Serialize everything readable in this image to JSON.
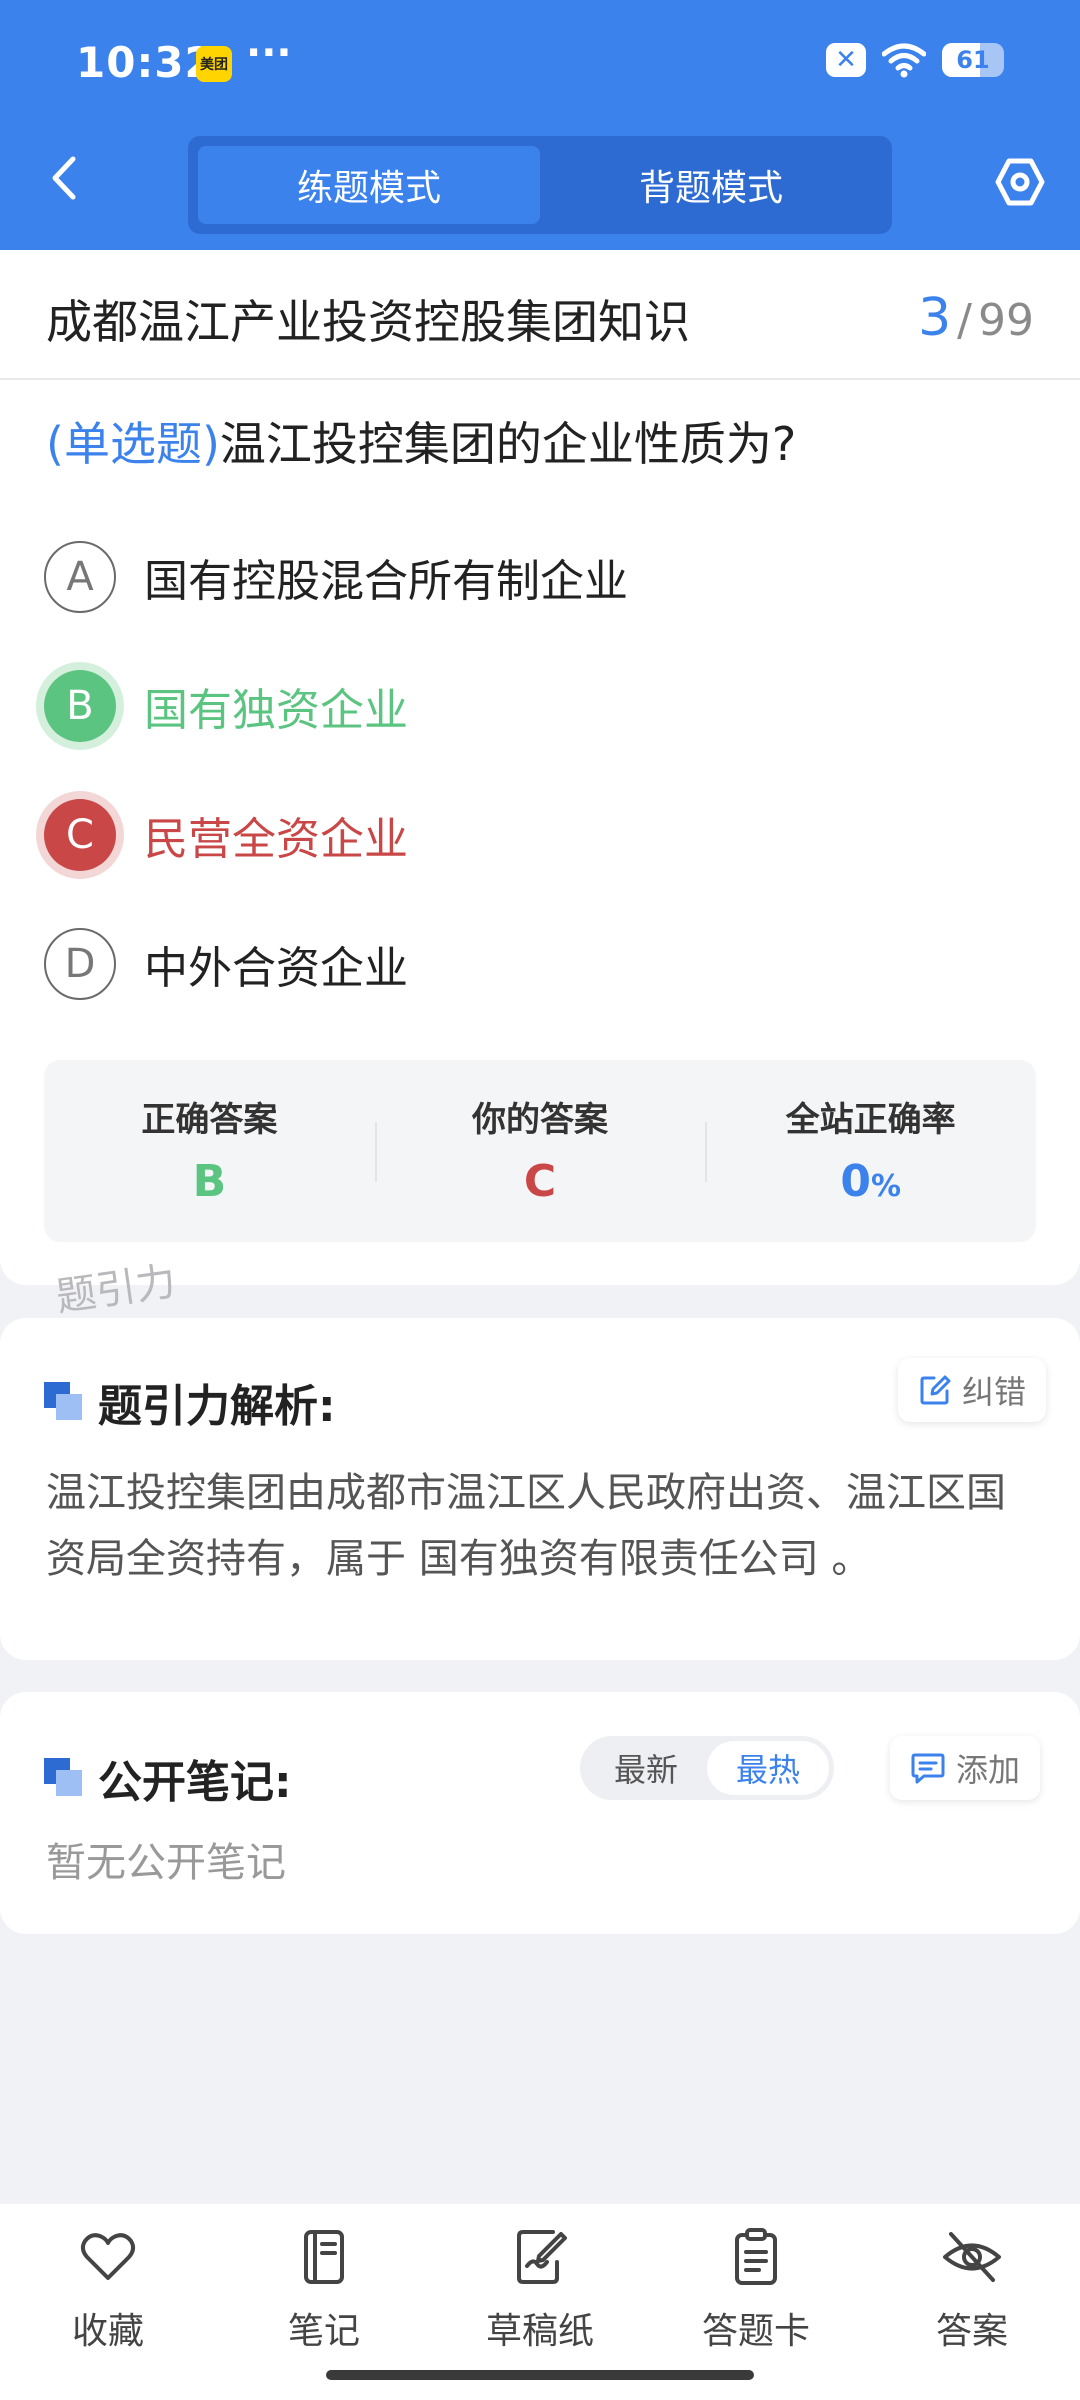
{
  "status_bar": {
    "time": "10:32",
    "app_badge": "美团",
    "more": "···",
    "battery": "61",
    "battery_level": 0.61
  },
  "header": {
    "modes": [
      "练题模式",
      "背题模式"
    ],
    "active_mode": 0
  },
  "question": {
    "bank_title": "成都温江产业投资控股集团知识",
    "progress_current": "3",
    "progress_separator": "/",
    "progress_total": "99",
    "type": "(单选题)",
    "text": "温江投控集团的企业性质为?",
    "options": [
      {
        "letter": "A",
        "text": "国有控股混合所有制企业"
      },
      {
        "letter": "B",
        "text": "国有独资企业"
      },
      {
        "letter": "C",
        "text": "民营全资企业"
      },
      {
        "letter": "D",
        "text": "中外合资企业"
      }
    ]
  },
  "result": {
    "correct_label": "正确答案",
    "correct_value": "B",
    "yours_label": "你的答案",
    "yours_value": "C",
    "rate_label": "全站正确率",
    "rate_value": "0",
    "rate_unit": "%"
  },
  "watermark": "题引力",
  "analysis": {
    "title": "题引力解析:",
    "report_label": "纠错",
    "text": "温江投控集团由成都市温江区人民政府出资、温江区国资局全资持有，属于 国有独资有限责任公司 。"
  },
  "notes": {
    "title": "公开笔记:",
    "sort_options": [
      "最新",
      "最热"
    ],
    "active_sort": 1,
    "add_label": "添加",
    "empty_text": "暂无公开笔记"
  },
  "bottom_nav": [
    {
      "label": "收藏",
      "icon": "heart-icon"
    },
    {
      "label": "笔记",
      "icon": "notebook-icon"
    },
    {
      "label": "草稿纸",
      "icon": "draft-paper-icon"
    },
    {
      "label": "答题卡",
      "icon": "answer-sheet-icon"
    },
    {
      "label": "答案",
      "icon": "eye-off-icon"
    }
  ],
  "colors": {
    "primary": "#3c82ec",
    "correct": "#5cc481",
    "wrong": "#c94747"
  }
}
